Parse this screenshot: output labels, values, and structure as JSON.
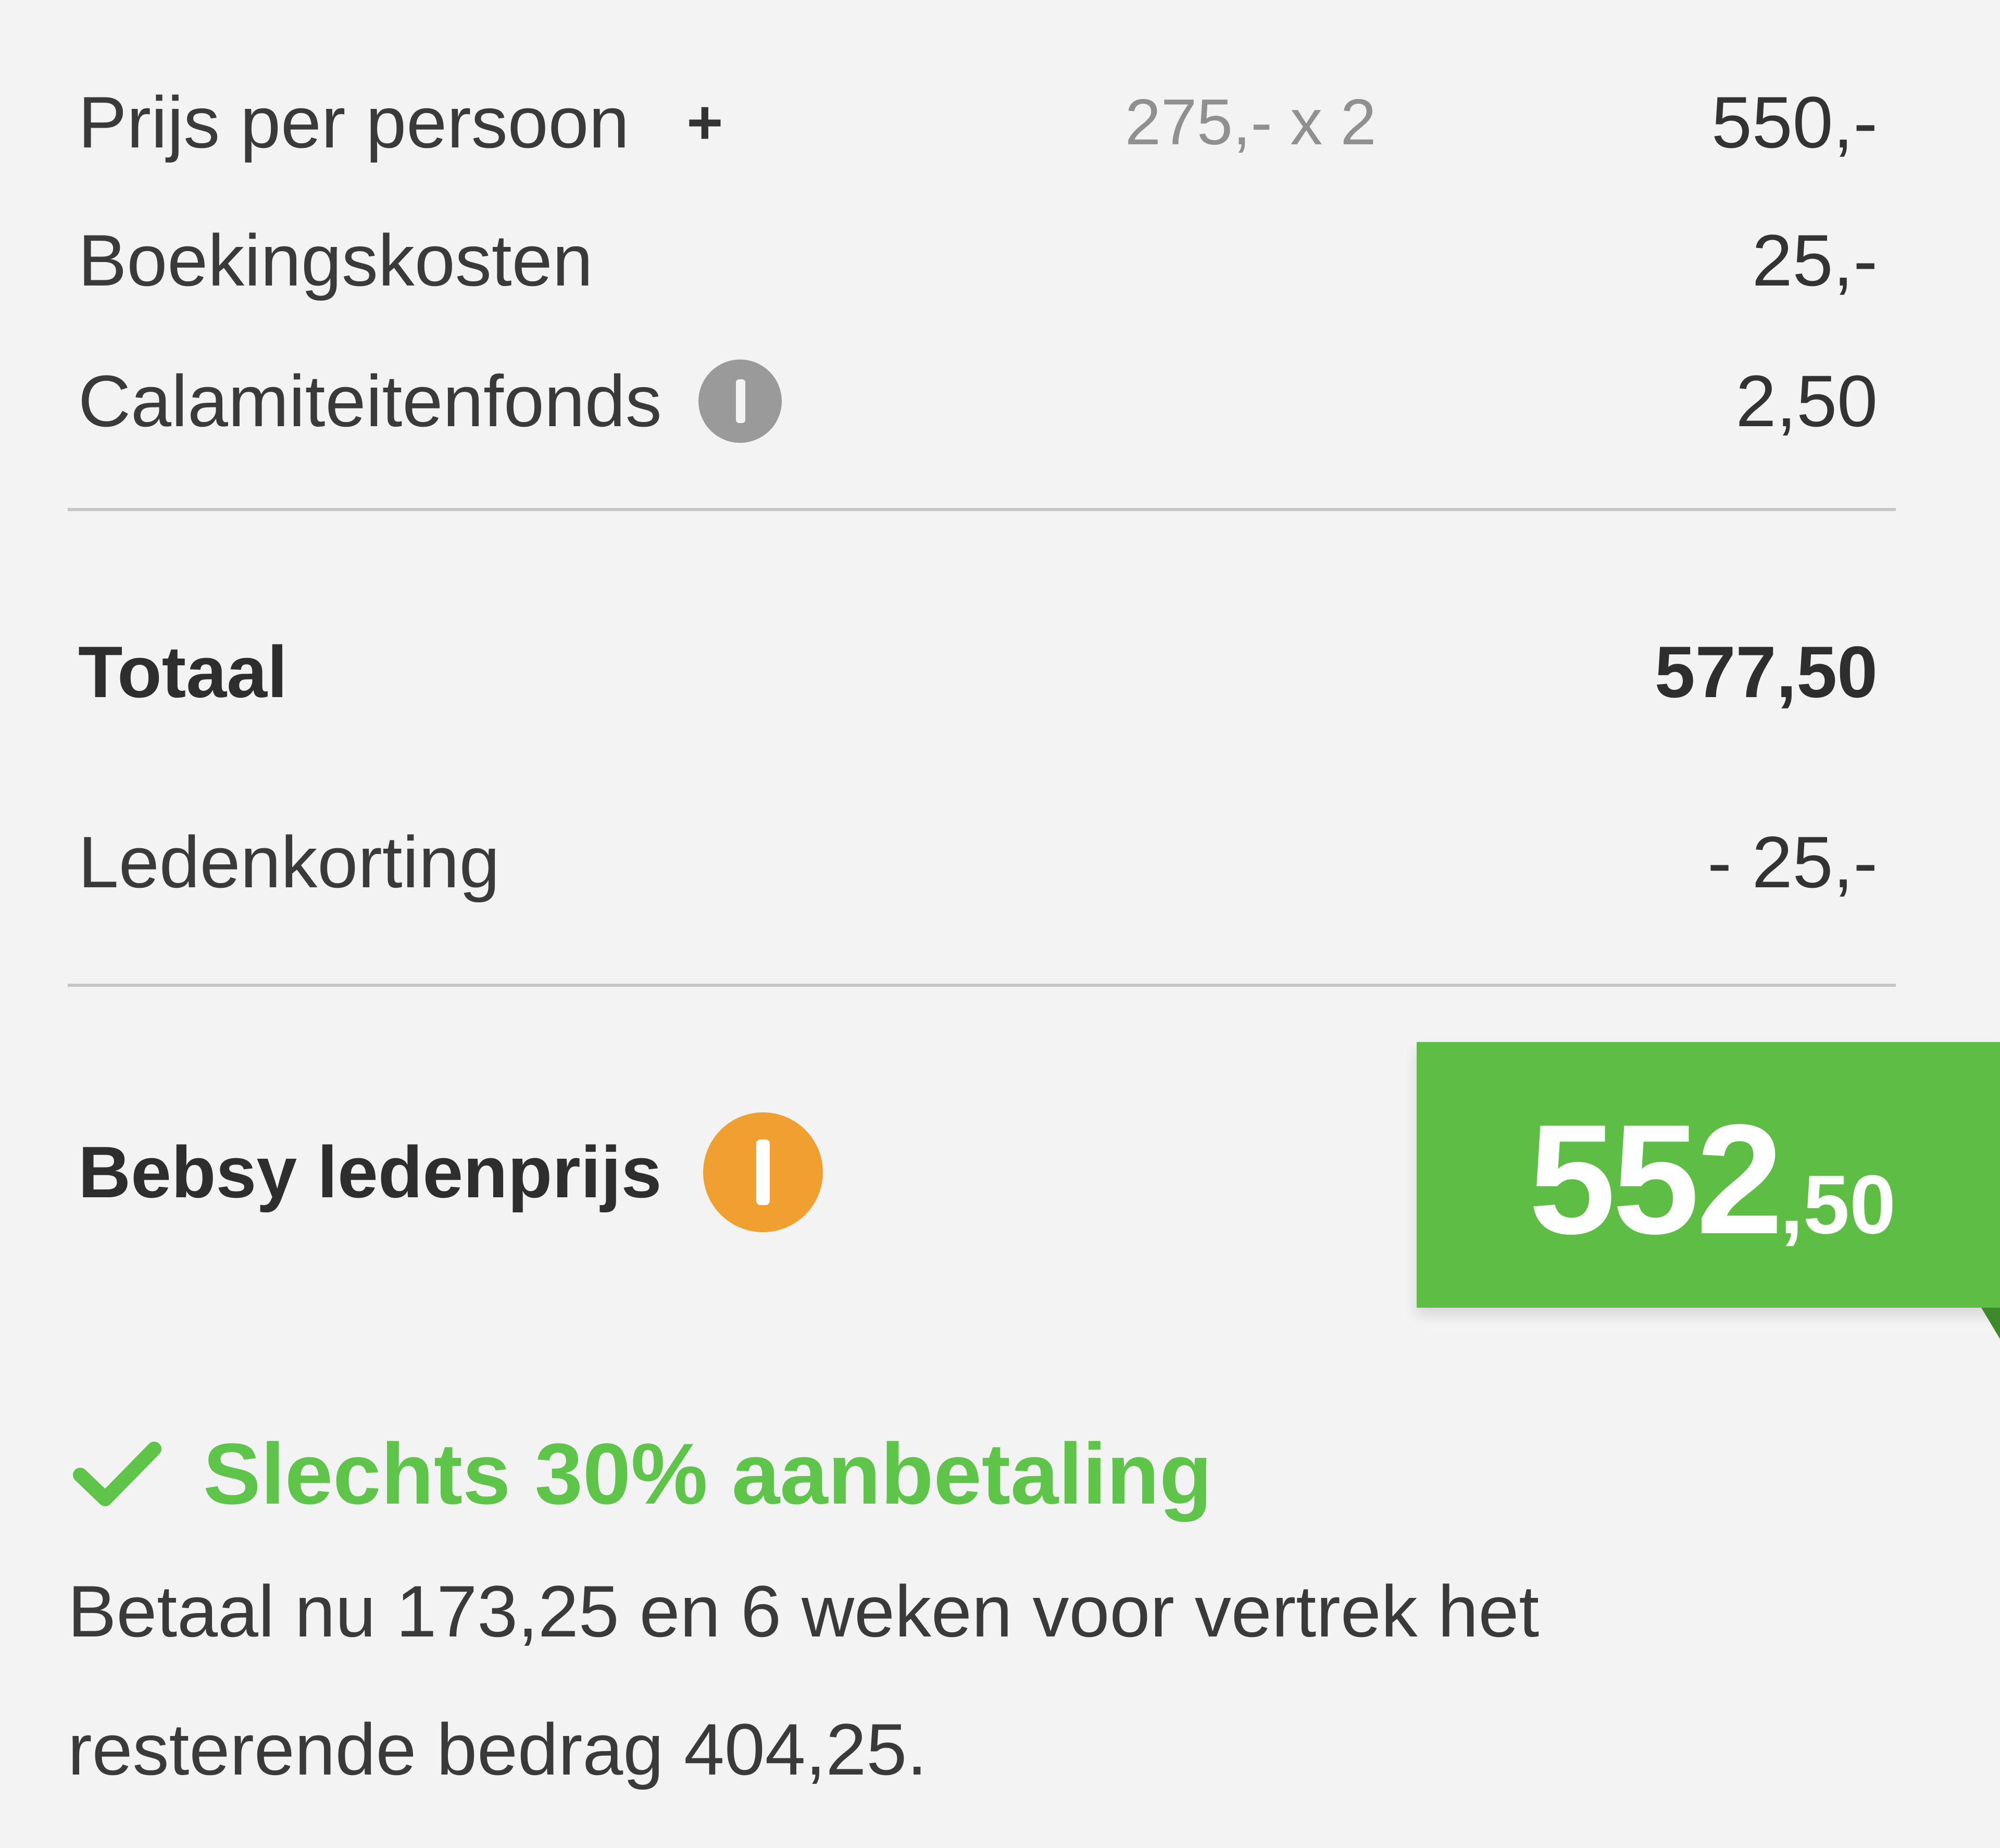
{
  "lines": {
    "price_per_person": {
      "label": "Prijs per persoon",
      "expand_symbol": "+",
      "calculation": "275,- x 2",
      "amount": "550,-"
    },
    "booking_costs": {
      "label": "Boekingskosten",
      "amount": "25,-"
    },
    "calamity_fund": {
      "label": "Calamiteitenfonds",
      "icon": "info-icon",
      "amount": "2,50"
    }
  },
  "total": {
    "label": "Totaal",
    "amount": "577,50"
  },
  "discount": {
    "label": "Ledenkorting",
    "amount": "- 25,-"
  },
  "member_price": {
    "label": "Bebsy ledenprijs",
    "icon": "info-icon",
    "amount_main": "552",
    "amount_cents": ",50"
  },
  "deposit": {
    "icon": "checkmark-icon",
    "title": "Slechts 30% aanbetaling",
    "text_line1": "Betaal nu 173,25 en 6 weken voor vertrek het",
    "text_line2": "resterende bedrag 404,25."
  },
  "colors": {
    "background": "#f3f3f3",
    "accent_green": "#5dbd45",
    "info_orange": "#f0a030",
    "info_grey": "#9a9a9a"
  }
}
